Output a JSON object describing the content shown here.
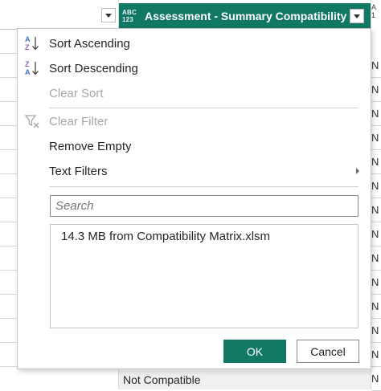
{
  "column_header": {
    "type_badge_top": "ABC",
    "type_badge_bottom": "123",
    "title": "Assessment - Summary Compatibility",
    "next_column_badge_top": "A",
    "next_column_badge_bottom": "1"
  },
  "next_column_cells": [
    "N",
    "N",
    "N",
    "N",
    "N",
    "N",
    "N",
    "N",
    "N",
    "N",
    "N",
    "N",
    "N",
    "N"
  ],
  "bottom_cell_value": "Not Compatible",
  "menu": {
    "sort_ascending": "Sort Ascending",
    "sort_descending": "Sort Descending",
    "clear_sort": "Clear Sort",
    "clear_filter": "Clear Filter",
    "remove_empty": "Remove Empty",
    "text_filters": "Text Filters"
  },
  "search": {
    "placeholder": "Search"
  },
  "values": [
    "14.3 MB from Compatibility Matrix.xlsm"
  ],
  "buttons": {
    "ok": "OK",
    "cancel": "Cancel"
  },
  "colors": {
    "accent": "#117865",
    "disabled_text": "#a6a6a6"
  }
}
